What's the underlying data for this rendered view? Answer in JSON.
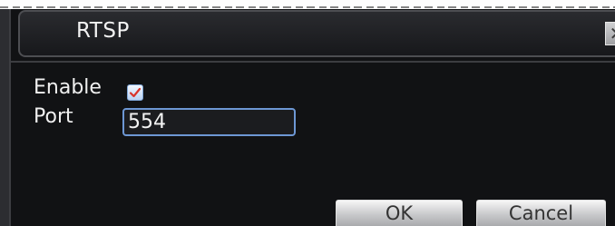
{
  "dialog": {
    "title": "RTSP",
    "close_glyph": "✕"
  },
  "form": {
    "enable_label": "Enable",
    "enable_checked": true,
    "port_label": "Port",
    "port_value": "554"
  },
  "buttons": {
    "ok_label": "OK",
    "cancel_label": "Cancel"
  },
  "colors": {
    "dialog_background": "#111214",
    "input_border": "#6d97d4",
    "check_mark": "#d9342b"
  }
}
